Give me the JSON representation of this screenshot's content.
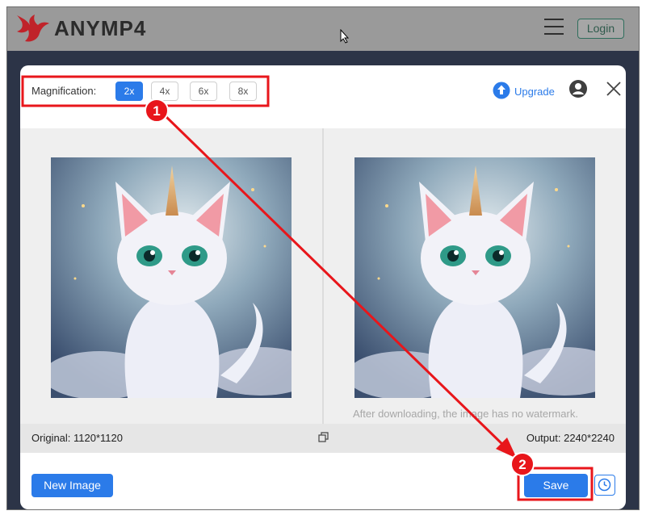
{
  "header": {
    "brand": "ANYMP4",
    "login_label": "Login"
  },
  "modal": {
    "magnification": {
      "label": "Magnification:",
      "options": [
        "2x",
        "4x",
        "6x",
        "8x"
      ],
      "selected": "2x"
    },
    "upgrade_label": "Upgrade",
    "watermark_note": "After downloading, the image has no watermark.",
    "original_label": "Original: 1120*1120",
    "output_label": "Output: 2240*2240",
    "new_image_label": "New Image",
    "save_label": "Save"
  },
  "annotations": {
    "step1": "1",
    "step2": "2",
    "highlight_color": "#e8161b"
  },
  "colors": {
    "accent": "#2b7be9",
    "brand_red": "#c0232a"
  },
  "icons": [
    "anymp4-logo-icon",
    "hamburger-menu-icon",
    "mouse-cursor-icon",
    "upgrade-arrow-icon",
    "user-icon",
    "close-icon",
    "compare-icon",
    "history-clock-icon"
  ]
}
